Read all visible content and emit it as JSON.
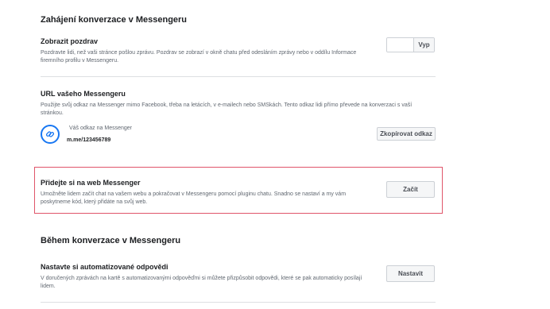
{
  "start": {
    "title": "Zahájení konverzace v Messengeru",
    "greeting": {
      "title": "Zobrazit pozdrav",
      "desc_line1": "Pozdravte lidi, než vaši stránce pošlou zprávu. Pozdrav se zobrazí v okně chatu před odesláním zprávy nebo v oddílu Informace",
      "desc_line2": "firemního profilu v Messengeru.",
      "toggle_label": "Vyp"
    },
    "url": {
      "title": "URL vašeho Messengeru",
      "desc_line1": "Použijte svůj odkaz na Messenger mimo Facebook, třeba na letácích, v e-mailech nebo SMSkách. Tento odkaz lidi přímo převede na konverzaci s vaší",
      "desc_line2": "stránkou.",
      "link_caption": "Váš odkaz na Messenger",
      "link_value": "m.me/123456789",
      "copy_button": "Zkopírovat odkaz",
      "icon": "link-icon"
    },
    "web": {
      "title": "Přidejte si na web Messenger",
      "desc_line1": "Umožněte lidem začít chat na vašem webu a pokračovat v Messengeru pomocí pluginu chatu. Snadno se nastaví a my vám",
      "desc_line2": "poskytneme kód, který přidáte na svůj web.",
      "start_button": "Začít"
    }
  },
  "during": {
    "title": "Během konverzace v Messengeru",
    "auto": {
      "title": "Nastavte si automatizované odpovědi",
      "desc_line1": "V doručených zprávách na kartě s automatizovanými odpověďmi si můžete přizpůsobit odpovědi, které se pak automaticky posílají",
      "desc_line2": "lidem.",
      "setup_button": "Nastavit"
    }
  },
  "colors": {
    "accent": "#1877f2",
    "highlight": "#e0556a",
    "divider": "#dddfe2"
  }
}
